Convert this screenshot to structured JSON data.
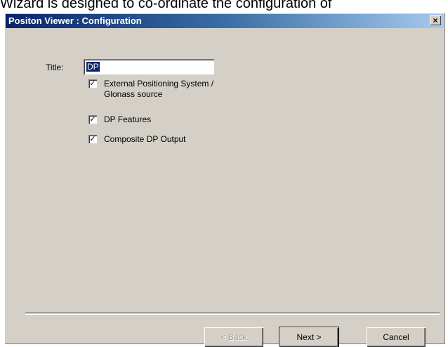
{
  "background_text": "Wizard is designed to co-ordinate the configuration of",
  "window": {
    "title": "Positon Viewer : Configuration",
    "close_glyph": "×"
  },
  "form": {
    "title_label": "Title:",
    "title_value": "DP",
    "options": [
      {
        "label": "External Positioning System / Glonass source",
        "checked": true
      },
      {
        "label": "DP Features",
        "checked": true
      },
      {
        "label": "Composite DP Output",
        "checked": true
      }
    ]
  },
  "buttons": {
    "back": "< Back",
    "next": "Next >",
    "cancel": "Cancel"
  },
  "check_glyph": "✓"
}
